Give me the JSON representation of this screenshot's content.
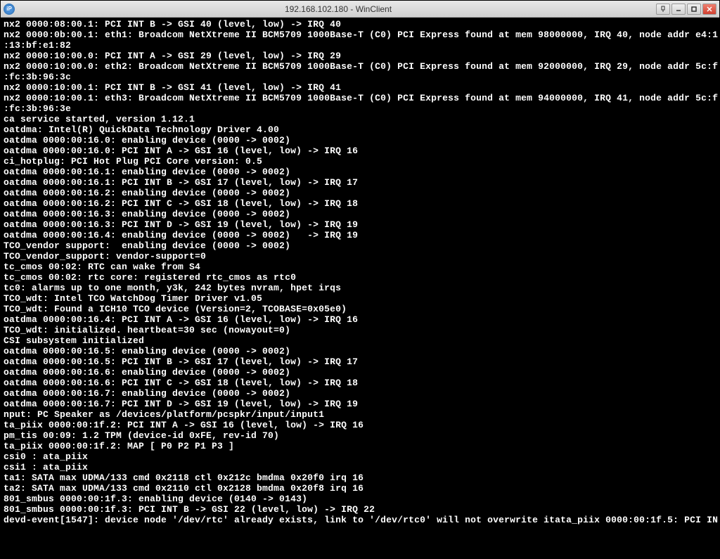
{
  "window": {
    "title": "192.168.102.180 - WinClient",
    "icon_label": "iP"
  },
  "terminal": {
    "lines": [
      "nx2 0000:08:00.1: PCI INT B -> GSI 40 (level, low) -> IRQ 40",
      "nx2 0000:0b:00.1: eth1: Broadcom NetXtreme II BCM5709 1000Base-T (C0) PCI Express found at mem 98000000, IRQ 40, node addr e4:1",
      ":13:bf:e1:82",
      "nx2 0000:10:00.0: PCI INT A -> GSI 29 (level, low) -> IRQ 29",
      "nx2 0000:10:00.0: eth2: Broadcom NetXtreme II BCM5709 1000Base-T (C0) PCI Express found at mem 92000000, IRQ 29, node addr 5c:f",
      ":fc:3b:96:3c",
      "nx2 0000:10:00.1: PCI INT B -> GSI 41 (level, low) -> IRQ 41",
      "nx2 0000:10:00.1: eth3: Broadcom NetXtreme II BCM5709 1000Base-T (C0) PCI Express found at mem 94000000, IRQ 41, node addr 5c:f",
      ":fc:3b:96:3e",
      "ca service started, version 1.12.1",
      "oatdma: Intel(R) QuickData Technology Driver 4.00",
      "oatdma 0000:00:16.0: enabling device (0000 -> 0002)",
      "oatdma 0000:00:16.0: PCI INT A -> GSI 16 (level, low) -> IRQ 16",
      "ci_hotplug: PCI Hot Plug PCI Core version: 0.5",
      "oatdma 0000:00:16.1: enabling device (0000 -> 0002)",
      "oatdma 0000:00:16.1: PCI INT B -> GSI 17 (level, low) -> IRQ 17",
      "oatdma 0000:00:16.2: enabling device (0000 -> 0002)",
      "oatdma 0000:00:16.2: PCI INT C -> GSI 18 (level, low) -> IRQ 18",
      "oatdma 0000:00:16.3: enabling device (0000 -> 0002)",
      "oatdma 0000:00:16.3: PCI INT D -> GSI 19 (level, low) -> IRQ 19",
      "oatdma 0000:00:16.4: enabling device (0000 -> 0002)   -> IRQ 19",
      "TCO_vendor support:  enabling device (0000 -> 0002)",
      "TCO_vendor_support: vendor-support=0",
      "tc_cmos 00:02: RTC can wake from S4",
      "tc_cmos 00:02: rtc core: registered rtc_cmos as rtc0",
      "tc0: alarms up to one month, y3k, 242 bytes nvram, hpet irqs",
      "TCO_wdt: Intel TCO WatchDog Timer Driver v1.05",
      "TCO_wdt: Found a ICH10 TCO device (Version=2, TCOBASE=0x05e0)",
      "oatdma 0000:00:16.4: PCI INT A -> GSI 16 (level, low) -> IRQ 16",
      "TCO_wdt: initialized. heartbeat=30 sec (nowayout=0)",
      "CSI subsystem initialized",
      "oatdma 0000:00:16.5: enabling device (0000 -> 0002)",
      "oatdma 0000:00:16.5: PCI INT B -> GSI 17 (level, low) -> IRQ 17",
      "oatdma 0000:00:16.6: enabling device (0000 -> 0002)",
      "oatdma 0000:00:16.6: PCI INT C -> GSI 18 (level, low) -> IRQ 18",
      "oatdma 0000:00:16.7: enabling device (0000 -> 0002)",
      "oatdma 0000:00:16.7: PCI INT D -> GSI 19 (level, low) -> IRQ 19",
      "nput: PC Speaker as /devices/platform/pcspkr/input/input1",
      "ta_piix 0000:00:1f.2: PCI INT A -> GSI 16 (level, low) -> IRQ 16",
      "pm_tis 00:09: 1.2 TPM (device-id 0xFE, rev-id 70)",
      "ta_piix 0000:00:1f.2: MAP [ P0 P2 P1 P3 ]",
      "csi0 : ata_piix",
      "csi1 : ata_piix",
      "ta1: SATA max UDMA/133 cmd 0x2118 ctl 0x212c bmdma 0x20f0 irq 16",
      "ta2: SATA max UDMA/133 cmd 0x2110 ctl 0x2128 bmdma 0x20f8 irq 16",
      "801_smbus 0000:00:1f.3: enabling device (0140 -> 0143)",
      "801_smbus 0000:00:1f.3: PCI INT B -> GSI 22 (level, low) -> IRQ 22",
      "devd-event[1547]: device node '/dev/rtc' already exists, link to '/dev/rtc0' will not overwrite itata_piix 0000:00:1f.5: PCI IN"
    ]
  }
}
